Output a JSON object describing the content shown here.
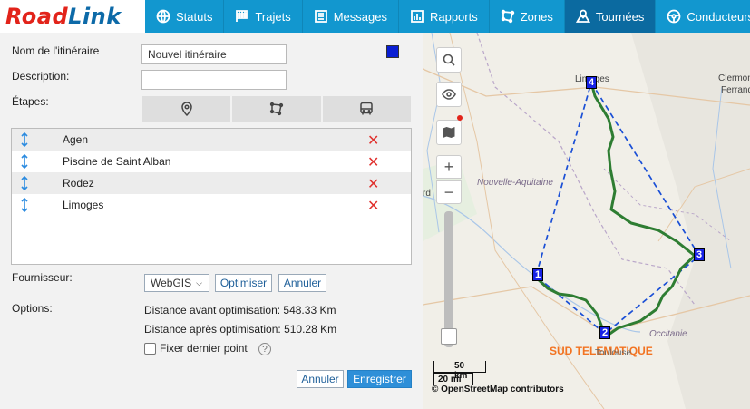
{
  "brand": {
    "part1": "Road",
    "part2": "Link"
  },
  "nav": [
    {
      "label": "Statuts",
      "icon": "globe-icon"
    },
    {
      "label": "Trajets",
      "icon": "flag-icon"
    },
    {
      "label": "Messages",
      "icon": "message-icon"
    },
    {
      "label": "Rapports",
      "icon": "report-icon"
    },
    {
      "label": "Zones",
      "icon": "zones-icon"
    },
    {
      "label": "Tournées",
      "icon": "map-route-icon",
      "active": true
    },
    {
      "label": "Conducteurs",
      "icon": "steering-icon"
    }
  ],
  "form": {
    "name_label": "Nom de l'itinéraire",
    "name_value": "Nouvel itinéraire",
    "description_label": "Description:",
    "description_value": "",
    "route_color": "#0a1fd3",
    "stages_label": "Étapes:",
    "stages": [
      {
        "name": "Agen"
      },
      {
        "name": "Piscine de Saint Alban"
      },
      {
        "name": "Rodez"
      },
      {
        "name": "Limoges"
      }
    ],
    "provider_label": "Fournisseur:",
    "provider_value": "WebGIS",
    "optimize_label": "Optimiser",
    "cancel_optim_label": "Annuler",
    "options_label": "Options:",
    "distance_before": "Distance avant optimisation: 548.33 Km",
    "distance_after": "Distance après optimisation: 510.28 Km",
    "fix_last_label": "Fixer dernier point",
    "help_symbol": "?",
    "cancel_label": "Annuler",
    "save_label": "Enregistrer"
  },
  "map": {
    "places": {
      "limoges": "Limoges",
      "clermont": "Clermon",
      "ferrand": "Ferrand",
      "bordeaux_fragment": "rd"
    },
    "regions": {
      "nouvelle_aquitaine": "Nouvelle-Aquitaine",
      "occitanie": "Occitanie"
    },
    "company_label": "SUD TELEMATIQUE",
    "company_sub": "Toulouse",
    "markers": [
      "1",
      "2",
      "3",
      "4"
    ],
    "scale_km": "50 km",
    "scale_mi": "20 mi",
    "attribution": "© OpenStreetMap contributors",
    "zoom_in": "+",
    "zoom_out": "−",
    "route_color": "#2e7d32",
    "optimized_line_color": "#1a4fd6"
  }
}
